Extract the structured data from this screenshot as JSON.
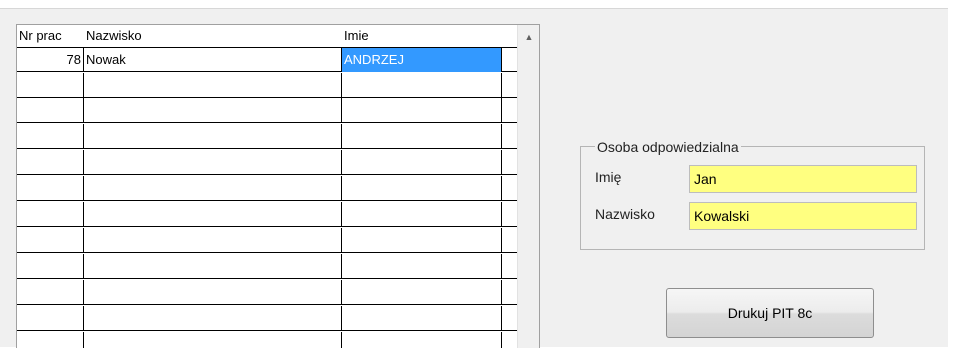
{
  "grid": {
    "columns": [
      "Nr prac",
      "Nazwisko",
      "Imie"
    ],
    "rows": [
      {
        "nr": "78",
        "nazwisko": "Nowak",
        "imie": "ANDRZEJ",
        "selected": true
      },
      {
        "nr": "",
        "nazwisko": "",
        "imie": ""
      },
      {
        "nr": "",
        "nazwisko": "",
        "imie": ""
      },
      {
        "nr": "",
        "nazwisko": "",
        "imie": ""
      },
      {
        "nr": "",
        "nazwisko": "",
        "imie": ""
      },
      {
        "nr": "",
        "nazwisko": "",
        "imie": ""
      },
      {
        "nr": "",
        "nazwisko": "",
        "imie": ""
      },
      {
        "nr": "",
        "nazwisko": "",
        "imie": ""
      },
      {
        "nr": "",
        "nazwisko": "",
        "imie": ""
      },
      {
        "nr": "",
        "nazwisko": "",
        "imie": ""
      },
      {
        "nr": "",
        "nazwisko": "",
        "imie": ""
      }
    ],
    "scroll_up_icon": "triangle-up-icon"
  },
  "responsible_person": {
    "title": "Osoba odpowiedzialna",
    "first_name_label": "Imię",
    "first_name_value": "Jan",
    "last_name_label": "Nazwisko",
    "last_name_value": "Kowalski",
    "field_color": "#ffff80"
  },
  "actions": {
    "print_label": "Drukuj PIT 8c"
  },
  "colors": {
    "selection": "#3399ff",
    "background": "#f0f0f0"
  }
}
